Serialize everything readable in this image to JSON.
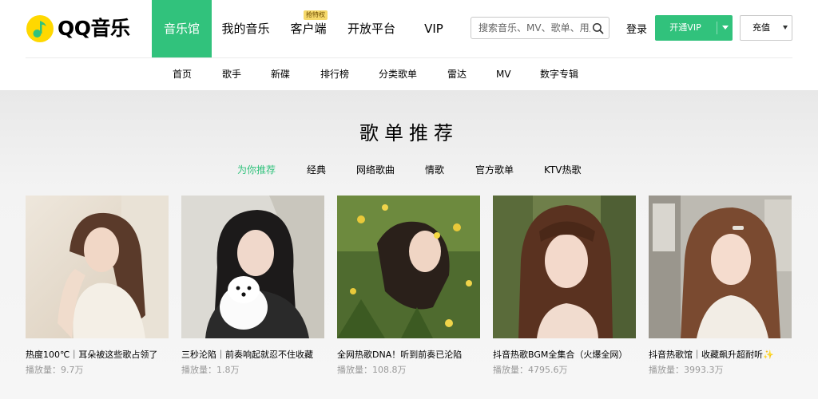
{
  "brand": {
    "name": "QQ音乐",
    "accent_color": "#31c27c"
  },
  "main_nav": [
    {
      "label": "音乐馆",
      "active": true
    },
    {
      "label": "我的音乐",
      "active": false
    },
    {
      "label": "客户端",
      "active": false,
      "badge": "抢特权"
    },
    {
      "label": "开放平台",
      "active": false
    },
    {
      "label": "VIP",
      "active": false
    }
  ],
  "search": {
    "placeholder": "搜索音乐、MV、歌单、用户",
    "icon": "search-icon"
  },
  "account": {
    "login_label": "登录",
    "vip_button_label": "开通VIP",
    "recharge_button_label": "充值"
  },
  "sub_nav": [
    "首页",
    "歌手",
    "新碟",
    "排行榜",
    "分类歌单",
    "雷达",
    "MV",
    "数字专辑"
  ],
  "section": {
    "title": "歌单推荐",
    "tabs": [
      {
        "label": "为你推荐",
        "active": true
      },
      {
        "label": "经典",
        "active": false
      },
      {
        "label": "网络歌曲",
        "active": false
      },
      {
        "label": "情歌",
        "active": false
      },
      {
        "label": "官方歌单",
        "active": false
      },
      {
        "label": "KTV热歌",
        "active": false
      }
    ]
  },
  "playlists": [
    {
      "title": "热度100℃｜耳朵被这些歌占领了",
      "plays_label": "播放量：",
      "plays": "9.7万"
    },
    {
      "title": "三秒沦陷｜前奏响起就忍不住收藏",
      "plays_label": "播放量：",
      "plays": "1.8万"
    },
    {
      "title": "全网热歌DNA！听到前奏已沦陷",
      "plays_label": "播放量：",
      "plays": "108.8万"
    },
    {
      "title": "抖音热歌BGM全集合（火爆全网）",
      "plays_label": "播放量：",
      "plays": "4795.6万"
    },
    {
      "title": "抖音热歌馆｜收藏飙升超耐听✨",
      "plays_label": "播放量：",
      "plays": "3993.3万"
    }
  ]
}
